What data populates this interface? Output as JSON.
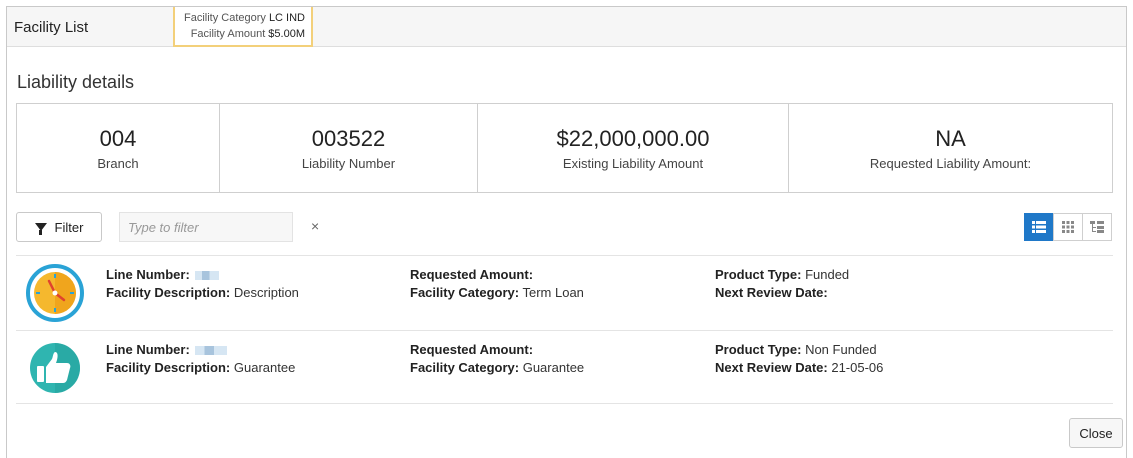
{
  "header": {
    "title": "Facility List",
    "tooltip": {
      "category_label": "Facility Category",
      "category_value": "LC IND",
      "amount_label": "Facility Amount",
      "amount_value": "$5.00M"
    }
  },
  "section_title": "Liability details",
  "summary": [
    {
      "value": "004",
      "label": "Branch"
    },
    {
      "value": "003522",
      "label": "Liability Number"
    },
    {
      "value": "$22,000,000.00",
      "label": "Existing Liability Amount"
    },
    {
      "value": "NA",
      "label": "Requested Liability Amount:"
    }
  ],
  "filter": {
    "button_label": "Filter",
    "placeholder": "Type to filter",
    "value": "",
    "clear_symbol": "×"
  },
  "views": [
    {
      "name": "list-view-icon",
      "active": true
    },
    {
      "name": "grid-view-icon",
      "active": false
    },
    {
      "name": "tree-view-icon",
      "active": false
    }
  ],
  "facilities": [
    {
      "icon": "clock-icon",
      "line_number_label": "Line Number:",
      "facility_description_label": "Facility Description:",
      "facility_description": "Description",
      "requested_amount_label": "Requested Amount:",
      "requested_amount": "",
      "facility_category_label": "Facility Category:",
      "facility_category": "Term Loan",
      "product_type_label": "Product Type:",
      "product_type": "Funded",
      "next_review_label": "Next Review Date:",
      "next_review_date": ""
    },
    {
      "icon": "thumbs-up-icon",
      "line_number_label": "Line Number:",
      "facility_description_label": "Facility Description:",
      "facility_description": "Guarantee",
      "requested_amount_label": "Requested Amount:",
      "requested_amount": "",
      "facility_category_label": "Facility Category:",
      "facility_category": "Guarantee",
      "product_type_label": "Product Type:",
      "product_type": "Non Funded",
      "next_review_label": "Next Review Date:",
      "next_review_date": "21-05-06"
    }
  ],
  "close_label": "Close",
  "colors": {
    "accent": "#1f78c8",
    "tooltip_border": "#f3d07a",
    "clock_ring": "#2aa3d6",
    "clock_face": "#f5b82e",
    "thumb_circle": "#2fb5b0"
  }
}
